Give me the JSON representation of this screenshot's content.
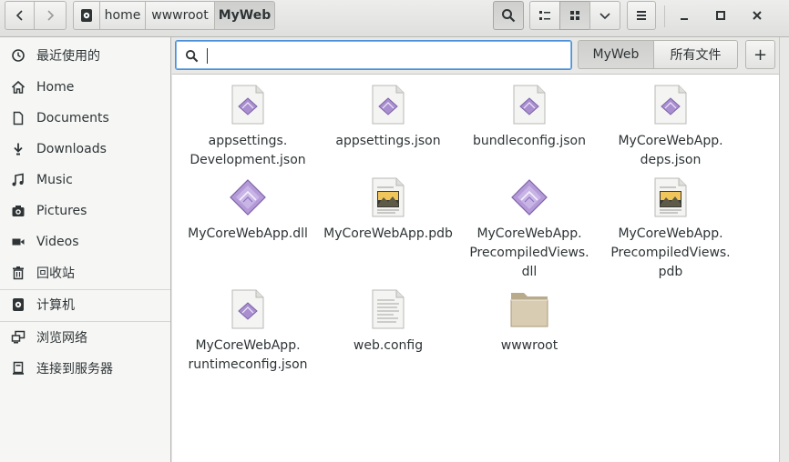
{
  "header": {
    "back_icon": "go-back-icon",
    "forward_icon": "go-forward-icon",
    "breadcrumbs": [
      {
        "label": "",
        "icon": "drive-icon"
      },
      {
        "label": "home"
      },
      {
        "label": "wwwroot"
      },
      {
        "label": "MyWeb",
        "active": true
      }
    ],
    "search_icon": "search-icon",
    "view_buttons": [
      "list-view-icon",
      "grid-view-icon",
      "chevron-down-icon"
    ],
    "menu_icon": "hamburger-menu-icon",
    "window_controls": [
      "minimize-icon",
      "maximize-icon",
      "close-icon"
    ]
  },
  "sidebar": {
    "items": [
      {
        "label": "最近使用的",
        "icon": "recent-clock-icon"
      },
      {
        "label": "Home",
        "icon": "home-icon"
      },
      {
        "label": "Documents",
        "icon": "document-icon"
      },
      {
        "label": "Downloads",
        "icon": "download-icon"
      },
      {
        "label": "Music",
        "icon": "music-icon"
      },
      {
        "label": "Pictures",
        "icon": "camera-icon"
      },
      {
        "label": "Videos",
        "icon": "video-icon"
      },
      {
        "label": "回收站",
        "icon": "trash-icon"
      },
      {
        "label": "计算机",
        "icon": "computer-drive-icon"
      },
      {
        "label": "浏览网络",
        "icon": "network-icon"
      },
      {
        "label": "连接到服务器",
        "icon": "server-icon"
      }
    ]
  },
  "search": {
    "value": "",
    "placeholder": "",
    "scope_current": "MyWeb",
    "scope_all": "所有文件",
    "add_label": "+"
  },
  "files": [
    {
      "name": "appsettings.\nDevelopment.json",
      "type": "json"
    },
    {
      "name": "appsettings.json",
      "type": "json"
    },
    {
      "name": "bundleconfig.json",
      "type": "json"
    },
    {
      "name": "MyCoreWebApp.\ndeps.json",
      "type": "json"
    },
    {
      "name": "MyCoreWebApp.dll",
      "type": "dll"
    },
    {
      "name": "MyCoreWebApp.pdb",
      "type": "pdb"
    },
    {
      "name": "MyCoreWebApp.\nPrecompiledViews.\ndll",
      "type": "dll"
    },
    {
      "name": "MyCoreWebApp.\nPrecompiledViews.\npdb",
      "type": "pdb"
    },
    {
      "name": "MyCoreWebApp.\nruntimeconfig.json",
      "type": "json"
    },
    {
      "name": "web.config",
      "type": "text"
    },
    {
      "name": "wwwroot",
      "type": "folder"
    }
  ],
  "colors": {
    "accent": "#4a90d9",
    "diamond": "#9b7ec8",
    "folder": "#d8cdb3"
  }
}
